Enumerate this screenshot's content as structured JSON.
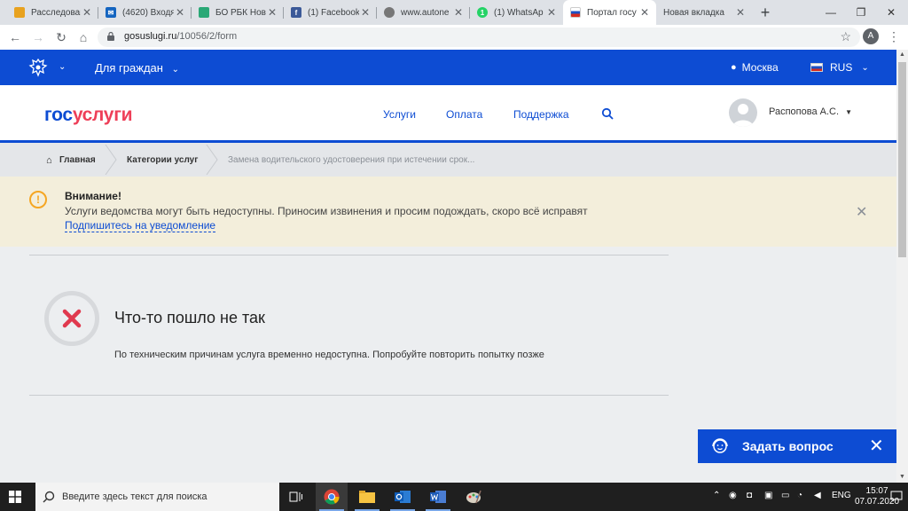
{
  "browser": {
    "tabs": [
      {
        "title": "Расследован",
        "favicon_color": "#e8a21f",
        "favicon_glyph": "◎"
      },
      {
        "title": "(4620) Входя",
        "favicon_color": "#1565c0",
        "favicon_glyph": "✉"
      },
      {
        "title": "БО РБК Нов",
        "favicon_color": "#2aa876",
        "favicon_glyph": "◢"
      },
      {
        "title": "(1) Facebook",
        "favicon_color": "#3b5998",
        "favicon_glyph": "f"
      },
      {
        "title": "www.autone",
        "favicon_color": "#777777",
        "favicon_glyph": "◍"
      },
      {
        "title": "(1) WhatsAp",
        "favicon_color": "#25d366",
        "favicon_glyph": "1"
      },
      {
        "title": "Портал госу",
        "favicon_color": "#1c4fc3",
        "favicon_glyph": ""
      },
      {
        "title": "Новая вкладка",
        "favicon_color": "",
        "favicon_glyph": ""
      }
    ],
    "new_tab": "+",
    "url_host": "gosuslugi.ru",
    "url_path": "/10056/2/form",
    "profile_initial": "A"
  },
  "topbar": {
    "citizens_label": "Для граждан",
    "city": "Москва",
    "lang": "RUS"
  },
  "header": {
    "logo_part1": "гос",
    "logo_part2": "услуги",
    "menu": [
      "Услуги",
      "Оплата",
      "Поддержка"
    ],
    "username": "Распопова А.С."
  },
  "breadcrumbs": [
    "Главная",
    "Категории услуг",
    "Замена водительского удостоверения при истечении срок..."
  ],
  "alert": {
    "title": "Внимание!",
    "text": "Услуги ведомства могут быть недоступны. Приносим извинения и просим подождать, скоро всё исправят",
    "link": "Подпишитесь на уведомление"
  },
  "error": {
    "title": "Что-то пошло не так",
    "text": "По техническим причинам услуга временно недоступна. Попробуйте повторить попытку позже"
  },
  "chat": {
    "label": "Задать вопрос"
  },
  "taskbar": {
    "search_placeholder": "Введите здесь текст для поиска",
    "lang": "ENG",
    "time": "15:07",
    "date": "07.07.2020"
  },
  "colors": {
    "brand_blue": "#0d4cd3",
    "brand_red": "#ee3f58",
    "alert_bg": "#f3eedb",
    "error_red": "#e0394e"
  }
}
